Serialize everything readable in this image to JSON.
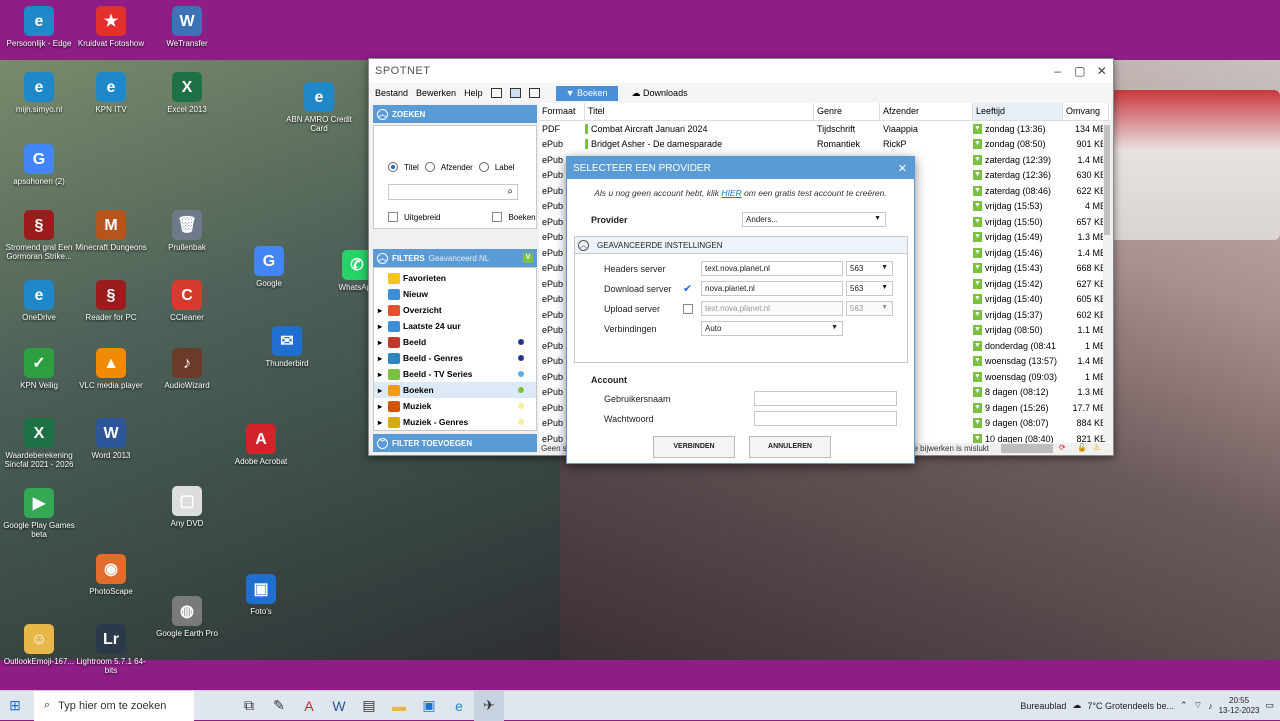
{
  "desktop": {
    "icons": [
      {
        "label": "Persoonlijk - Edge",
        "glyph": "e",
        "color": "#1e88c8"
      },
      {
        "label": "Kruidvat Fotoshow",
        "glyph": "★",
        "color": "#e2312d"
      },
      {
        "label": "WeTransfer",
        "glyph": "W",
        "color": "#3c73b6"
      },
      {
        "label": "mijn.simyo.nl",
        "glyph": "e",
        "color": "#1e88c8"
      },
      {
        "label": "KPN ITV",
        "glyph": "e",
        "color": "#1e88c8"
      },
      {
        "label": "Excel 2013",
        "glyph": "X",
        "color": "#1e7145"
      },
      {
        "label": "ABN AMRO Credit Card",
        "glyph": "e",
        "color": "#1e88c8"
      },
      {
        "label": "apsohonen (2)",
        "glyph": "G",
        "color": "#4285f4"
      },
      {
        "label": "Stromend gral Een Gormoran Strike...",
        "glyph": "§",
        "color": "#9b1c1c"
      },
      {
        "label": "Minecraft Dungeons",
        "glyph": "M",
        "color": "#b5541c"
      },
      {
        "label": "Prullenbak",
        "glyph": "🗑",
        "color": "#6c7a89"
      },
      {
        "label": "Google",
        "glyph": "G",
        "color": "#4285f4"
      },
      {
        "label": "WhatsApp",
        "glyph": "✆",
        "color": "#25d366"
      },
      {
        "label": "OneDrive",
        "glyph": "e",
        "color": "#1e88c8"
      },
      {
        "label": "Reader for PC",
        "glyph": "§",
        "color": "#9b1c1c"
      },
      {
        "label": "CCleaner",
        "glyph": "C",
        "color": "#d63b2f"
      },
      {
        "label": "Thunderbird",
        "glyph": "✉",
        "color": "#1f6fd1"
      },
      {
        "label": "KPN Veilig",
        "glyph": "✓",
        "color": "#2e9f41"
      },
      {
        "label": "VLC media player",
        "glyph": "▲",
        "color": "#f08a00"
      },
      {
        "label": "AudioWizard",
        "glyph": "♪",
        "color": "#6b3b2a"
      },
      {
        "label": "Waardeberekening Sincfal 2021 - 2026",
        "glyph": "X",
        "color": "#1e7145"
      },
      {
        "label": "Word 2013",
        "glyph": "W",
        "color": "#2b579a"
      },
      {
        "label": "Adobe Acrobat",
        "glyph": "A",
        "color": "#d2232a"
      },
      {
        "label": "Google Play Games beta",
        "glyph": "▶",
        "color": "#34a853"
      },
      {
        "label": "Any DVD",
        "glyph": "▢",
        "color": "#dddddd"
      },
      {
        "label": "PhotoScape",
        "glyph": "◉",
        "color": "#e46c2b"
      },
      {
        "label": "Foto's",
        "glyph": "▣",
        "color": "#1f6fd1"
      },
      {
        "label": "OutlookEmoji-167...",
        "glyph": "☺",
        "color": "#e8b74a"
      },
      {
        "label": "Lightroom 5.7.1 64-bits",
        "glyph": "Lr",
        "color": "#2b3a4a"
      },
      {
        "label": "Google Earth Pro",
        "glyph": "◍",
        "color": "#7a7a7a"
      }
    ]
  },
  "app": {
    "title": "SPOTNET",
    "menu": [
      "Bestand",
      "Bewerken",
      "Help"
    ],
    "tabs": [
      "Boeken",
      "Downloads"
    ],
    "zoeken": {
      "header": "ZOEKEN",
      "radios": [
        "Titel",
        "Afzender",
        "Label"
      ],
      "checks": [
        "Uitgebreid",
        "Boeken"
      ]
    },
    "filters": {
      "header": "FILTERS",
      "mode": "Geavanceerd NL",
      "items": [
        {
          "label": "Favorieten",
          "color": "#f5c518",
          "dot": ""
        },
        {
          "label": "Nieuw",
          "color": "#3b8fd9",
          "dot": ""
        },
        {
          "label": "Overzicht",
          "color": "#e0522e",
          "dot": ""
        },
        {
          "label": "Laatste 24 uur",
          "color": "#3b8fd9",
          "dot": ""
        },
        {
          "label": "Beeld",
          "color": "#c0392b",
          "dot": "#1e3a8a"
        },
        {
          "label": "Beeld - Genres",
          "color": "#2e86c1",
          "dot": "#1e3a8a"
        },
        {
          "label": "Beeld - TV Series",
          "color": "#7ac142",
          "dot": "#5dade2"
        },
        {
          "label": "Boeken",
          "color": "#f39c12",
          "dot": "#7ac142"
        },
        {
          "label": "Muziek",
          "color": "#d35400",
          "dot": "#f4f1a0"
        },
        {
          "label": "Muziek - Genres",
          "color": "#d4ac0d",
          "dot": "#f4f1a0"
        }
      ],
      "add": "FILTER TOEVOEGEN"
    },
    "grid": {
      "columns": [
        "Formaat",
        "Titel",
        "Genre",
        "Afzender",
        "Leeftijd",
        "Omvang"
      ],
      "rows": [
        [
          "PDF",
          "Combat Aircraft Januari 2024",
          "Tijdschrift",
          "Viaappia",
          "zondag (13:36)",
          "134 MB"
        ],
        [
          "ePub",
          "Bridget Asher - De damesparade",
          "Romantiek",
          "RickP",
          "zondag (08:50)",
          "901 KB"
        ],
        [
          "ePub",
          "",
          "",
          "",
          "zaterdag (12:39)",
          "1.4 MB"
        ],
        [
          "ePub",
          "",
          "",
          "",
          "zaterdag (12:36)",
          "630 KB"
        ],
        [
          "ePub",
          "",
          "",
          "",
          "zaterdag (08:46)",
          "622 KB"
        ],
        [
          "ePub",
          "",
          "",
          "",
          "vrijdag (15:53)",
          "4 MB"
        ],
        [
          "ePub",
          "",
          "",
          "",
          "vrijdag (15:50)",
          "657 KB"
        ],
        [
          "ePub",
          "",
          "",
          "",
          "vrijdag (15:49)",
          "1.3 MB"
        ],
        [
          "ePub",
          "",
          "",
          "",
          "vrijdag (15:46)",
          "1.4 MB"
        ],
        [
          "ePub",
          "",
          "",
          "",
          "vrijdag (15:43)",
          "668 KB"
        ],
        [
          "ePub",
          "",
          "",
          "",
          "vrijdag (15:42)",
          "627 KB"
        ],
        [
          "ePub",
          "",
          "",
          "",
          "vrijdag (15:40)",
          "605 KB"
        ],
        [
          "ePub",
          "",
          "",
          "",
          "vrijdag (15:37)",
          "602 KB"
        ],
        [
          "ePub",
          "",
          "",
          "",
          "vrijdag (08:50)",
          "1.1 MB"
        ],
        [
          "ePub",
          "",
          "",
          "",
          "donderdag (08:41",
          "1 MB"
        ],
        [
          "ePub",
          "",
          "",
          "an",
          "woensdag (13:57)",
          "1.4 MB"
        ],
        [
          "ePub",
          "",
          "",
          "",
          "woensdag (09:03)",
          "1 MB"
        ],
        [
          "ePub",
          "",
          "",
          "",
          "8 dagen (08:12)",
          "1.3 MB"
        ],
        [
          "ePub",
          "",
          "",
          "13",
          "9 dagen (15:26)",
          "17.7 MB"
        ],
        [
          "ePub",
          "",
          "",
          "",
          "9 dagen (08:07)",
          "884 KB"
        ],
        [
          "ePub",
          "",
          "",
          "",
          "10 dagen (08:40)",
          "821 KB"
        ]
      ],
      "status_left": "Geen sp",
      "status_right": "ase bijwerken is mislukt"
    }
  },
  "dialog": {
    "title": "SELECTEER EEN PROVIDER",
    "info_pre": "Als u nog geen account hebt, klik ",
    "info_link": "HIER",
    "info_post": " om een gratis test account te creëren.",
    "provider_label": "Provider",
    "provider_value": "Anders...",
    "advanced_header": "GEAVANCEERDE INSTELLINGEN",
    "headers_label": "Headers server",
    "headers_value": "text.nova.planet.nl",
    "headers_port": "563",
    "download_label": "Download server",
    "download_value": "nova.planet.nl",
    "download_port": "563",
    "upload_label": "Upload server",
    "upload_value": "text.nova.planet.nl",
    "upload_port": "563",
    "connections_label": "Verbindingen",
    "connections_value": "Auto",
    "account_header": "Account",
    "user_label": "Gebruikersnaam",
    "pass_label": "Wachtwoord",
    "connect": "VERBINDEN",
    "cancel": "ANNULEREN"
  },
  "taskbar": {
    "search_placeholder": "Typ hier om te zoeken",
    "desktop_label": "Bureaublad",
    "weather": "7°C Grotendeels be...",
    "time": "20:55",
    "date": "13-12-2023"
  }
}
